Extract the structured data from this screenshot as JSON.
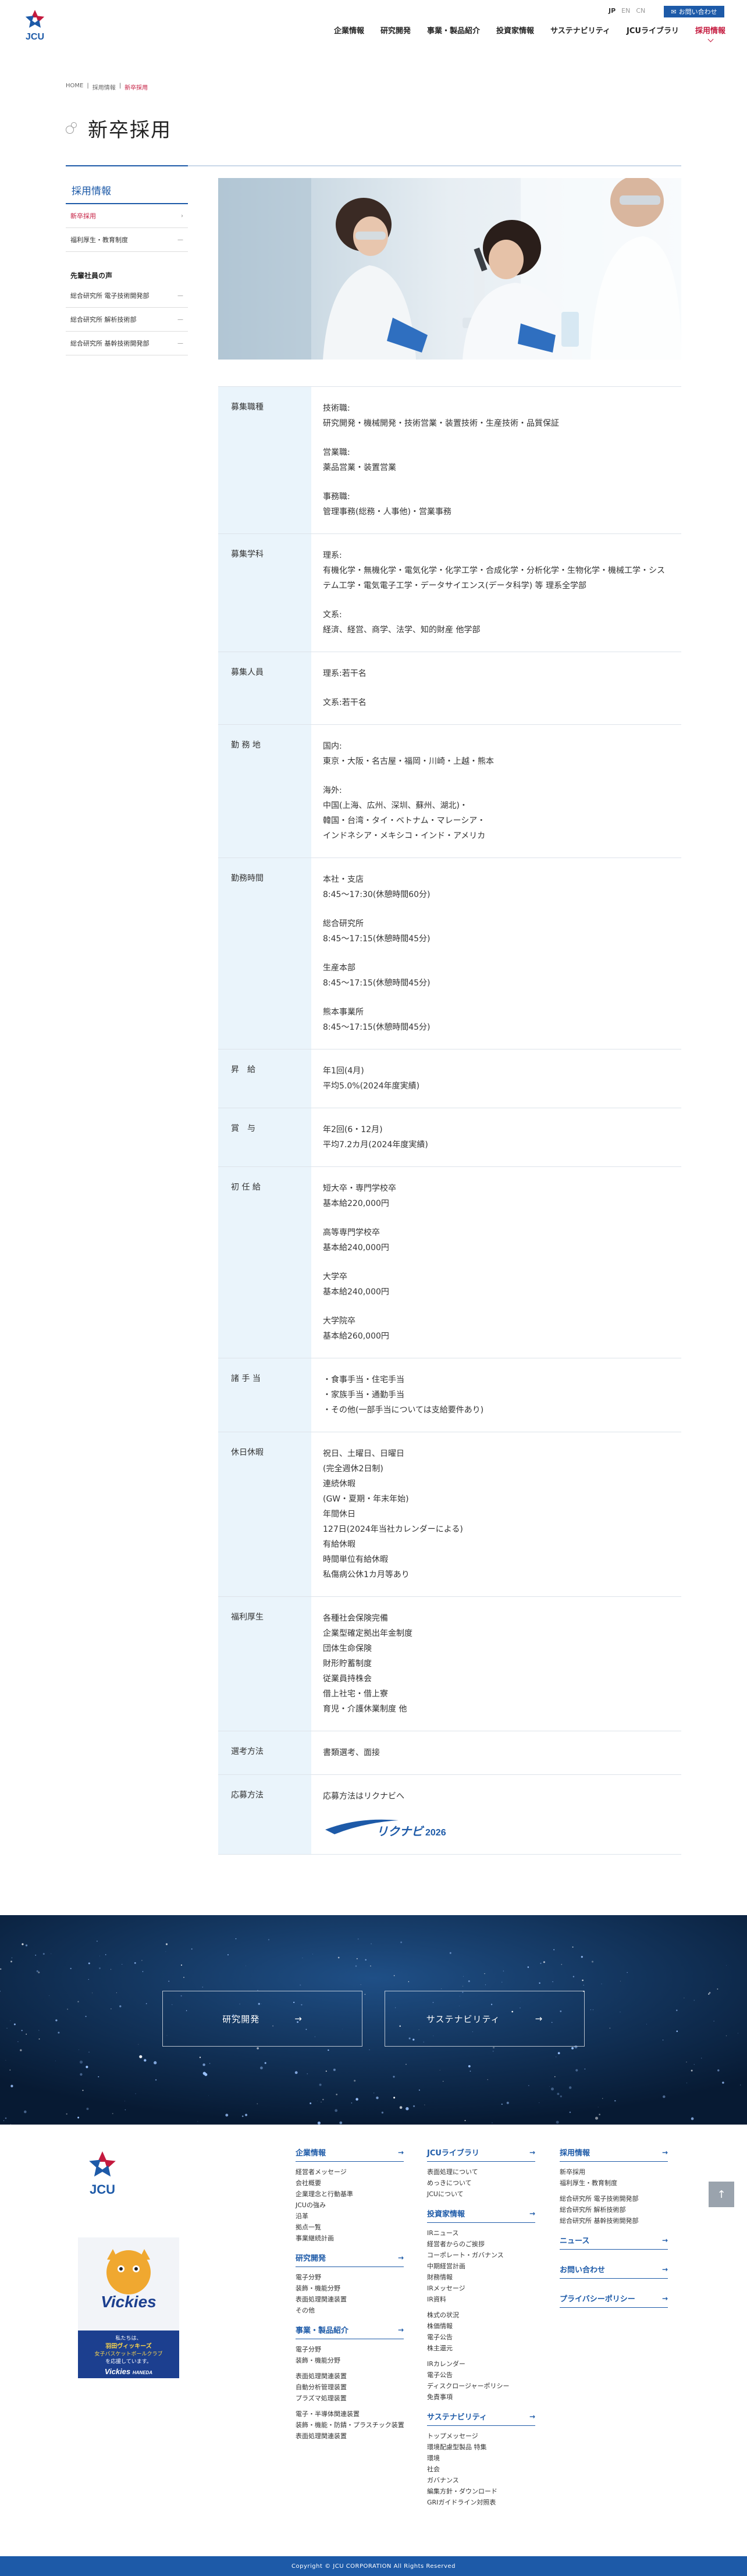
{
  "header": {
    "logo_text": "JCU",
    "lang": [
      "JP",
      "EN",
      "CN"
    ],
    "contact": "お問い合わせ",
    "nav": [
      "企業情報",
      "研究開発",
      "事業・製品紹介",
      "投資家情報",
      "サステナビリティ",
      "JCUライブラリ",
      "採用情報"
    ]
  },
  "breadcrumb": [
    "HOME",
    "採用情報",
    "新卒採用"
  ],
  "page_title": "新卒採用",
  "side": {
    "head": "採用情報",
    "items": [
      "新卒採用",
      "福利厚生・教育制度"
    ],
    "voices_head": "先輩社員の声",
    "voices": [
      "総合研究所 電子技術開発部",
      "総合研究所 解析技術部",
      "総合研究所 基幹技術開発部"
    ]
  },
  "table": [
    {
      "th": "募集職種",
      "td": [
        [
          "技術職:",
          "研究開発・機械開発・技術営業・装置技術・生産技術・品質保証"
        ],
        [
          "営業職:",
          "薬品営業・装置営業"
        ],
        [
          "事務職:",
          "管理事務(総務・人事他)・営業事務"
        ]
      ]
    },
    {
      "th": "募集学科",
      "td": [
        [
          "理系:",
          "有機化学・無機化学・電気化学・化学工学・合成化学・分析化学・生物化学・機械工学・システム工学・電気電子工学・データサイエンス(データ科学) 等 理系全学部"
        ],
        [
          "文系:",
          "経済、経営、商学、法学、知的財産 他学部"
        ]
      ]
    },
    {
      "th": "募集人員",
      "td": [
        [
          "理系:若干名"
        ],
        [
          "文系:若干名"
        ]
      ]
    },
    {
      "th": "勤 務 地",
      "td": [
        [
          "国内:",
          "東京・大阪・名古屋・福岡・川崎・上越・熊本"
        ],
        [
          "海外:",
          "中国(上海、広州、深圳、蘇州、湖北)・",
          "韓国・台湾・タイ・ベトナム・マレーシア・",
          "インドネシア・メキシコ・インド・アメリカ"
        ]
      ]
    },
    {
      "th": "勤務時間",
      "td": [
        [
          "本社・支店",
          "8:45〜17:30(休憩時間60分)"
        ],
        [
          "総合研究所",
          "8:45〜17:15(休憩時間45分)"
        ],
        [
          "生産本部",
          "8:45〜17:15(休憩時間45分)"
        ],
        [
          "熊本事業所",
          "8:45〜17:15(休憩時間45分)"
        ]
      ]
    },
    {
      "th": "昇　給",
      "td": [
        [
          "年1回(4月)",
          "平均5.0%(2024年度実績)"
        ]
      ]
    },
    {
      "th": "賞　与",
      "td": [
        [
          "年2回(6・12月)",
          "平均7.2カ月(2024年度実績)"
        ]
      ]
    },
    {
      "th": "初 任 給",
      "td": [
        [
          "短大卒・専門学校卒",
          "基本給220,000円"
        ],
        [
          "高等専門学校卒",
          "基本給240,000円"
        ],
        [
          "大学卒",
          "基本給240,000円"
        ],
        [
          "大学院卒",
          "基本給260,000円"
        ]
      ]
    },
    {
      "th": "諸 手 当",
      "td": [
        [
          "・食事手当・住宅手当",
          "・家族手当・通勤手当",
          "・その他(一部手当については支給要件あり)"
        ]
      ]
    },
    {
      "th": "休日休暇",
      "td": [
        [
          "祝日、土曜日、日曜日",
          "(完全週休2日制)",
          "連続休暇",
          "(GW・夏期・年末年始)",
          "年間休日",
          "127日(2024年当社カレンダーによる)",
          "有給休暇",
          "時間単位有給休暇",
          "私傷病公休1カ月等あり"
        ]
      ]
    },
    {
      "th": "福利厚生",
      "td": [
        [
          "各種社会保険完備",
          "企業型確定拠出年金制度",
          "団体生命保険",
          "財形貯蓄制度",
          "従業員持株会",
          "借上社宅・借上寮",
          "育児・介護休業制度 他"
        ]
      ]
    },
    {
      "th": "選考方法",
      "td": [
        [
          "書類選考、面接"
        ]
      ]
    },
    {
      "th": "応募方法",
      "td": [
        [
          "応募方法はリクナビへ"
        ]
      ]
    }
  ],
  "rikunabi": {
    "label": "リクナビ",
    "year": "2026"
  },
  "banner": {
    "buttons": [
      "研究開発",
      "サステナビリティ"
    ]
  },
  "footer": {
    "vickies": {
      "top": "私たちは、",
      "mid": "羽田ヴィッキーズ",
      "sub": "女子バスケットボールクラブ",
      "end": "を応援しています。",
      "brand": "Vickies",
      "brand2": "Vickies",
      "brand_tag": "HANEDA"
    },
    "col1": [
      {
        "h": "企業情報",
        "items": [
          "経営者メッセージ",
          "会社概要",
          "企業理念と行動基準",
          "JCUの強み",
          "沿革",
          "拠点一覧",
          "事業継続計画"
        ]
      },
      {
        "h": "研究開発",
        "items": [
          "電子分野",
          "装飾・機能分野",
          "表面処理関連装置",
          "その他"
        ]
      },
      {
        "h": "事業・製品紹介",
        "items": [
          "電子分野",
          "装飾・機能分野",
          "",
          "表面処理関連装置",
          "自動分析管理装置",
          "プラズマ処理装置",
          "",
          "電子・半導体関連装置",
          "装飾・機能・防錆・プラスチック装置",
          "表面処理関連装置"
        ]
      }
    ],
    "col2": [
      {
        "h": "JCUライブラリ",
        "items": [
          "表面処理について",
          "めっきについて",
          "JCUについて"
        ]
      },
      {
        "h": "投資家情報",
        "items": [
          "IRニュース",
          "経営者からのご挨拶",
          "コーポレート・ガバナンス",
          "中期経営計画",
          "財務情報",
          "IRメッセージ",
          "IR資料",
          "",
          "株式の状況",
          "株価情報",
          "電子公告",
          "株主還元",
          "",
          "IRカレンダー",
          "電子公告",
          "ディスクロージャーポリシー",
          "免責事項"
        ]
      },
      {
        "h": "サステナビリティ",
        "items": [
          "トップメッセージ",
          "環境配慮型製品 特集",
          "環境",
          "社会",
          "ガバナンス",
          "編集方針・ダウンロード",
          "GRIガイドライン対照表"
        ]
      }
    ],
    "col3": [
      {
        "h": "採用情報",
        "items": [
          "新卒採用",
          "福利厚生・教育制度",
          "",
          "総合研究所 電子技術開発部",
          "総合研究所 解析技術部",
          "総合研究所 基幹技術開発部"
        ]
      },
      {
        "h": "ニュース",
        "items": []
      },
      {
        "h": "お問い合わせ",
        "items": []
      },
      {
        "h": "プライバシーポリシー",
        "items": []
      }
    ]
  },
  "copyright": "Copyright © JCU CORPORATION All Rights Reserved",
  "colors": {
    "brand_blue": "#1d5aa8",
    "accent_red": "#c41a3e",
    "table_head_bg": "#eaf4fb"
  }
}
